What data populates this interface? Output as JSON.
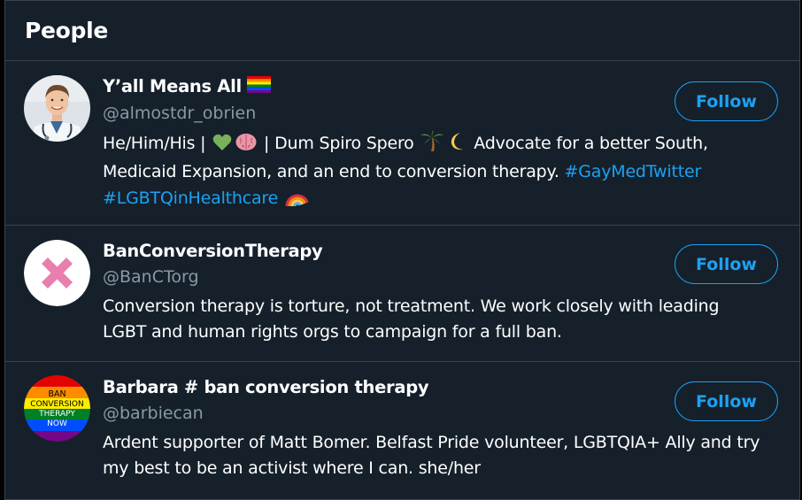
{
  "panel": {
    "title": "People"
  },
  "users": [
    {
      "name": "Y’all Means All",
      "name_emoji": "rainbow-flag-icon",
      "handle": "@almostdr_obrien",
      "bio_part1": "He/Him/His | ",
      "bio_emoji_1": "green-heart-icon",
      "bio_emoji_2": "brain-icon",
      "bio_part2": " | Dum Spiro Spero ",
      "bio_emoji_3": "palm-tree-icon",
      "bio_emoji_4": "crescent-moon-icon",
      "bio_part3": " Advocate for a better South, Medicaid Expansion, and an end to conversion therapy. ",
      "hashtag_1": "#GayMedTwitter",
      "hashtag_2": "#LGBTQinHealthcare",
      "bio_emoji_5": "rainbow-icon",
      "follow_label": "Follow"
    },
    {
      "name": "BanConversionTherapy",
      "handle": "@BanCTorg",
      "bio": "Conversion therapy is torture, not treatment. We work closely with leading LGBT and human rights orgs to campaign for a full ban.",
      "follow_label": "Follow"
    },
    {
      "name": "Barbara # ban conversion therapy",
      "handle": "@barbiecan",
      "bio": "Ardent supporter of Matt Bomer. Belfast Pride volunteer, LGBTQIA+ Ally and try my best to be an activist where I can. she/her",
      "follow_label": "Follow",
      "avatar_text": [
        "BAN",
        "CONVERSION",
        "THERAPY",
        "NOW"
      ]
    }
  ],
  "colors": {
    "background": "#15202b",
    "border": "#38444d",
    "accent": "#1da1f2",
    "secondary_text": "#8899a6",
    "primary_text": "#ffffff"
  }
}
